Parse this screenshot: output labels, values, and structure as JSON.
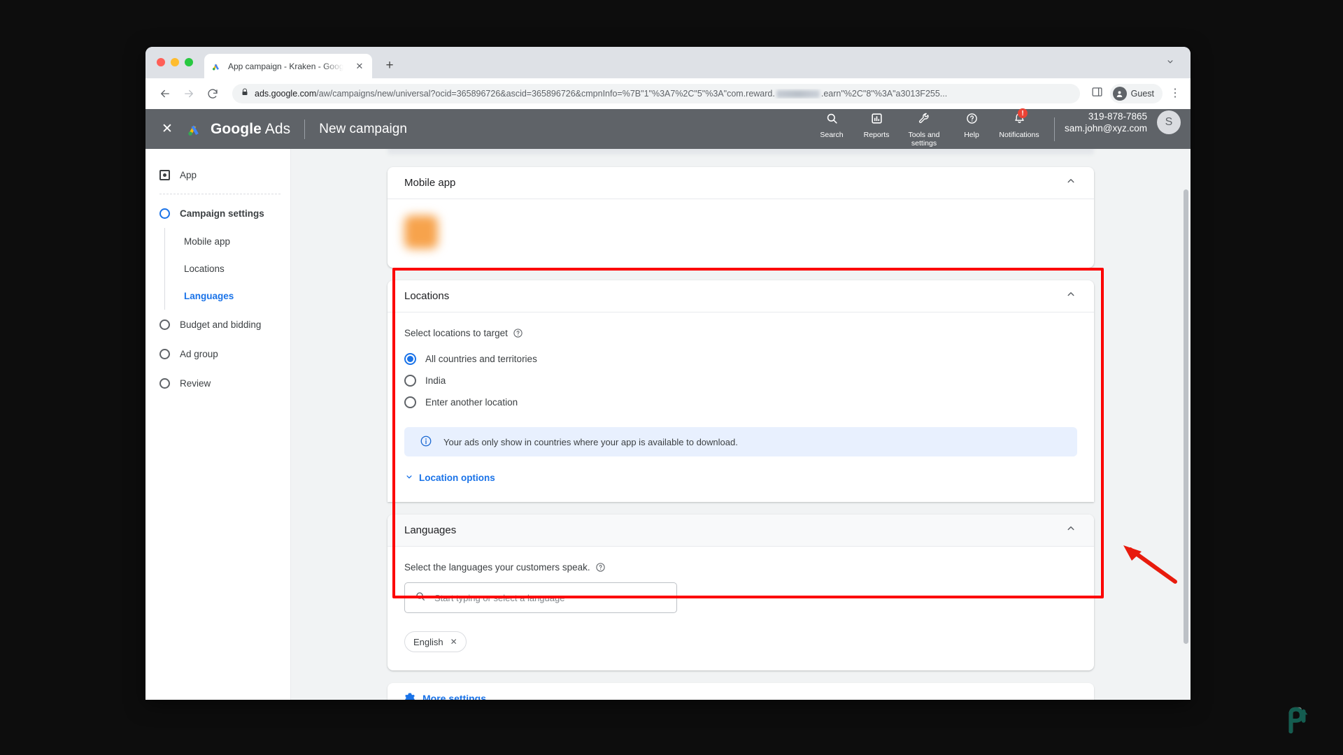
{
  "browser": {
    "tab": {
      "title": "App campaign - Kraken - Goog",
      "favicon": "google-ads-icon",
      "close": "✕",
      "new_tab": "+"
    },
    "tabstrip_caret": "⌄",
    "nav": {
      "back": "←",
      "forward": "→",
      "reload": "⟳"
    },
    "url": {
      "lock": "lock-icon",
      "domain": "ads.google.com",
      "path_before": "/aw/campaigns/new/universal?ocid=365896726&ascid=365896726&cmpnInfo=%7B\"1\"%3A7%2C\"5\"%3A\"com.reward.",
      "redacted": "redacted-text",
      "path_after": ".earn\"%2C\"8\"%3A\"a3013F255..."
    },
    "profile": {
      "label": "Guest",
      "avatar": "person-icon"
    },
    "sidepanel_icon": "side-panel-icon",
    "menu_icon": "three-dot-menu-icon"
  },
  "app_header": {
    "close_label": "✕",
    "brand_bold": "Google",
    "brand_light": "Ads",
    "page_title": "New campaign",
    "actions": [
      {
        "label": "Search",
        "icon": "search-icon"
      },
      {
        "label": "Reports",
        "icon": "reports-icon"
      },
      {
        "label": "Tools and settings",
        "icon": "wrench-icon"
      },
      {
        "label": "Help",
        "icon": "help-icon"
      },
      {
        "label": "Notifications",
        "icon": "bell-icon",
        "badge": "!"
      }
    ],
    "account": {
      "phone": "319-878-7865",
      "email": "sam.john@xyz.com",
      "avatar_initial": "S"
    }
  },
  "sidebar": {
    "items": [
      {
        "label": "App",
        "icon": "app-icon",
        "state": "done"
      },
      {
        "label": "Campaign settings",
        "icon": "step-circle-icon",
        "state": "active"
      },
      {
        "label": "Budget and bidding",
        "icon": "step-circle-icon",
        "state": "idle"
      },
      {
        "label": "Ad group",
        "icon": "step-circle-icon",
        "state": "idle"
      },
      {
        "label": "Review",
        "icon": "step-circle-icon",
        "state": "idle"
      }
    ],
    "sub_items": [
      {
        "label": "Mobile app",
        "current": false
      },
      {
        "label": "Locations",
        "current": false
      },
      {
        "label": "Languages",
        "current": true
      }
    ]
  },
  "main": {
    "mobile_app_card": {
      "title": "Mobile app",
      "collapse_icon": "chevron-up-icon",
      "app_name_redacted": "redacted-app-name"
    },
    "locations_card": {
      "title": "Locations",
      "collapse_icon": "chevron-up-icon",
      "field_label": "Select locations to target",
      "help_icon": "help-circle-icon",
      "options": [
        {
          "label": "All countries and territories",
          "selected": true
        },
        {
          "label": "India",
          "selected": false
        },
        {
          "label": "Enter another location",
          "selected": false
        }
      ],
      "info_icon": "info-circle-icon",
      "info_text": "Your ads only show in countries where your app is available to download.",
      "expand_link": "Location options",
      "expand_caret": "chevron-down-icon"
    },
    "languages_card": {
      "title": "Languages",
      "collapse_icon": "chevron-up-icon",
      "field_label": "Select the languages your customers speak.",
      "help_icon": "help-circle-icon",
      "search_icon": "search-icon",
      "search_placeholder": "Start typing or select a language",
      "search_value": "",
      "chips": [
        {
          "label": "English",
          "remove_icon": "close-icon",
          "remove": "✕"
        }
      ]
    },
    "more_settings": {
      "label": "More settings",
      "icon": "settings-gear-icon"
    }
  },
  "annotation": {
    "highlight_color": "#fc0000",
    "arrow": "red-arrow-pointing-left"
  },
  "watermark": {
    "name": "p-logo-watermark",
    "color": "#1e6b5e"
  }
}
